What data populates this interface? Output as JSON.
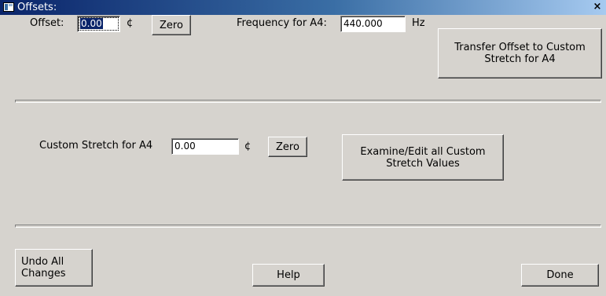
{
  "window": {
    "title": "Offsets:",
    "close_glyph": "×"
  },
  "offset": {
    "label": "Offset:",
    "value": "0.00",
    "unit": "¢",
    "zero_label": "Zero"
  },
  "frequency": {
    "label": "Frequency for A4:",
    "value": "440.000",
    "unit": "Hz"
  },
  "transfer_button": {
    "line1": "Transfer Offset to Custom",
    "line2": "Stretch for A4"
  },
  "custom_stretch": {
    "label": "Custom Stretch for A4",
    "value": "0.00",
    "unit": "¢",
    "zero_label": "Zero"
  },
  "examine_button": {
    "line1": "Examine/Edit all Custom",
    "line2": "Stretch Values"
  },
  "footer": {
    "undo_line1": "Undo All",
    "undo_line2": "Changes",
    "help_label": "Help",
    "done_label": "Done"
  },
  "colors": {
    "dialog_bg": "#d6d3ce",
    "title_start": "#0a246a",
    "title_end": "#a6caf0",
    "selection": "#0a246a"
  },
  "icons": [
    "app-window-icon",
    "close-icon"
  ]
}
